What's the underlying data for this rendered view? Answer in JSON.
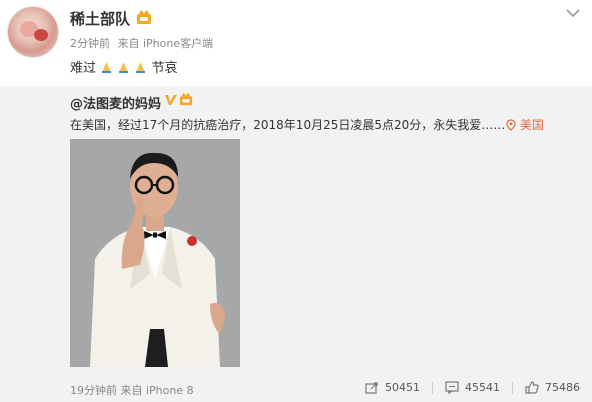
{
  "post": {
    "username": "稀土部队",
    "time": "2分钟前",
    "source": "来自 iPhone客户端",
    "text_before": "难过",
    "text_after": "节哀",
    "emoji": "pray-icon"
  },
  "repost": {
    "author": "@法图麦的妈妈",
    "text": "在美国，经过17个月的抗癌治疗，2018年10月25日凌晨5点20分，永失我爱……",
    "location": "美国",
    "time": "19分钟前",
    "source": "来自 iPhone 8",
    "reposts": "50451",
    "comments": "45541",
    "likes": "75486"
  },
  "colors": {
    "location": "#e46a3a",
    "repost_bg": "#f2f2f5",
    "vip_gold": "#f5a623"
  }
}
